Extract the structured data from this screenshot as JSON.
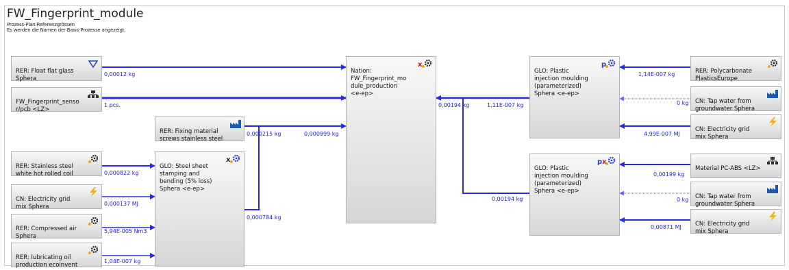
{
  "header": {
    "title": "FW_Fingerprint_module",
    "subtitle1": "Prozess-Plan:Referenzgrössen",
    "subtitle2": "Es werden die Namen der Basis-Prozesse angezeigt."
  },
  "colors": {
    "flow": "#2a2ae0",
    "flow_light": "#6a6af0",
    "text": "#1a1ad6"
  },
  "nodes": {
    "float_glass": {
      "label": "RER: Float flat glass\nSphera",
      "icon": "diamond-icon"
    },
    "sensor": {
      "label": "FW_Fingerprint_senso\nr/pcb <LZ>",
      "icon": "plan-icon"
    },
    "fixing": {
      "label": "RER: Fixing material\nscrews stainless steel",
      "icon": "factory-icon"
    },
    "stainless": {
      "label": "RER: Stainless steel\nwhite hot rolled coil",
      "icon": "gear-icon"
    },
    "elec1": {
      "label": "CN: Electricity grid\nmix Sphera",
      "icon": "bolt-icon"
    },
    "air": {
      "label": "RER: Compressed air\nSphera",
      "icon": "gear-icon"
    },
    "oil": {
      "label": "RER: lubricating oil\nproduction ecoinvent",
      "icon": "gear-icon"
    },
    "stamping": {
      "label": "GLO: Steel sheet\nstamping and\nbending (5% loss)\nSphera <e-ep>",
      "icon": "x-gear-icon"
    },
    "nation": {
      "label": "Nation:\nFW_Fingerprint_mo\ndule_production\n<e-ep>",
      "icon": "x-gear-icon"
    },
    "mould1": {
      "label": "GLO: Plastic\ninjection moulding\n(parameterized)\nSphera <e-ep>",
      "icon": "p-gear-icon"
    },
    "mould2": {
      "label": "GLO: Plastic\ninjection moulding\n(parameterized)\nSphera <e-ep>",
      "icon": "px-gear-icon"
    },
    "pc": {
      "label": "RER: Polycarbonate\nPlasticsEurope",
      "icon": "gear-icon"
    },
    "water1": {
      "label": "CN: Tap water from\ngroundwater Sphera",
      "icon": "factory-icon"
    },
    "elec2": {
      "label": "CN: Electricity grid\nmix Sphera",
      "icon": "bolt-icon"
    },
    "pcabs": {
      "label": "Material PC-ABS <LZ>",
      "icon": "plan-icon"
    },
    "water2": {
      "label": "CN: Tap water from\ngroundwater Sphera",
      "icon": "factory-icon"
    },
    "elec3": {
      "label": "CN: Electricity grid\nmix Sphera",
      "icon": "bolt-icon"
    }
  },
  "flows": {
    "glass": "0,00012 kg",
    "sensor": "1 pcs.",
    "fix_out": "0,000215 kg",
    "fix_in": "0,000999 kg",
    "stainless": "0,000822 kg",
    "elec1": "0,000137 MJ",
    "air": "5,94E-005 Nm3",
    "oil": "1,04E-007 kg",
    "stamp_out": "0,000784 kg",
    "nation_in": "0,00194 kg",
    "mould1_out": "1,11E-007 kg",
    "pc": "1,14E-007 kg",
    "water1": "0 kg",
    "elec2": "4,99E-007 MJ",
    "mould2_out": "0,00194 kg",
    "pcabs": "0,00199 kg",
    "water2": "0 kg",
    "elec3": "0,00871 MJ"
  }
}
